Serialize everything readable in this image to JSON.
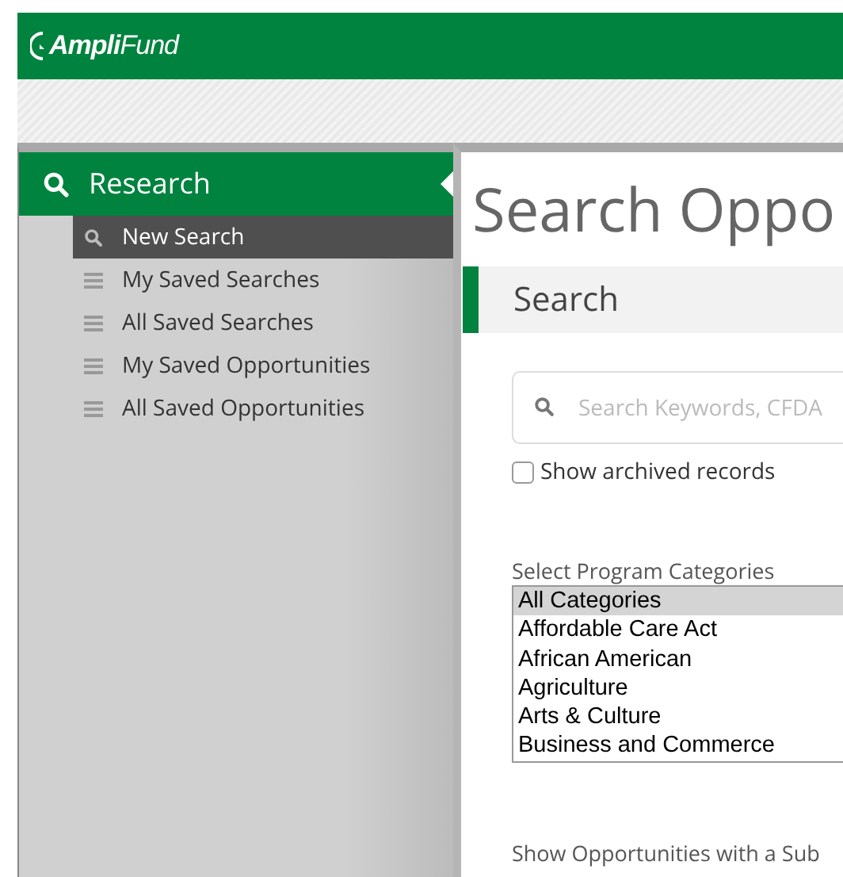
{
  "header": {
    "logo": "**Ampli**Fund"
  },
  "sidebar": {
    "section": "Research",
    "items": [
      {
        "label": "New Search",
        "selected": true
      },
      {
        "label": "My Saved Searches",
        "selected": false
      },
      {
        "label": "All Saved Searches",
        "selected": false
      },
      {
        "label": "My Saved Opportunities",
        "selected": false
      },
      {
        "label": "All Saved Opportunities",
        "selected": false
      }
    ]
  },
  "main": {
    "title": "Search Oppo",
    "section_title": "Search",
    "search": {
      "placeholder": "Search Keywords, CFDA"
    },
    "archived": {
      "label": "Show archived records",
      "checked": false
    },
    "categories": {
      "label": "Select Program Categories",
      "options": [
        {
          "label": "All Categories",
          "selected": true
        },
        {
          "label": "Affordable Care Act",
          "selected": false
        },
        {
          "label": "African American",
          "selected": false
        },
        {
          "label": "Agriculture",
          "selected": false
        },
        {
          "label": "Arts & Culture",
          "selected": false
        },
        {
          "label": "Business and Commerce",
          "selected": false
        }
      ]
    },
    "footer_text": "Show Opportunities with a Sub"
  }
}
